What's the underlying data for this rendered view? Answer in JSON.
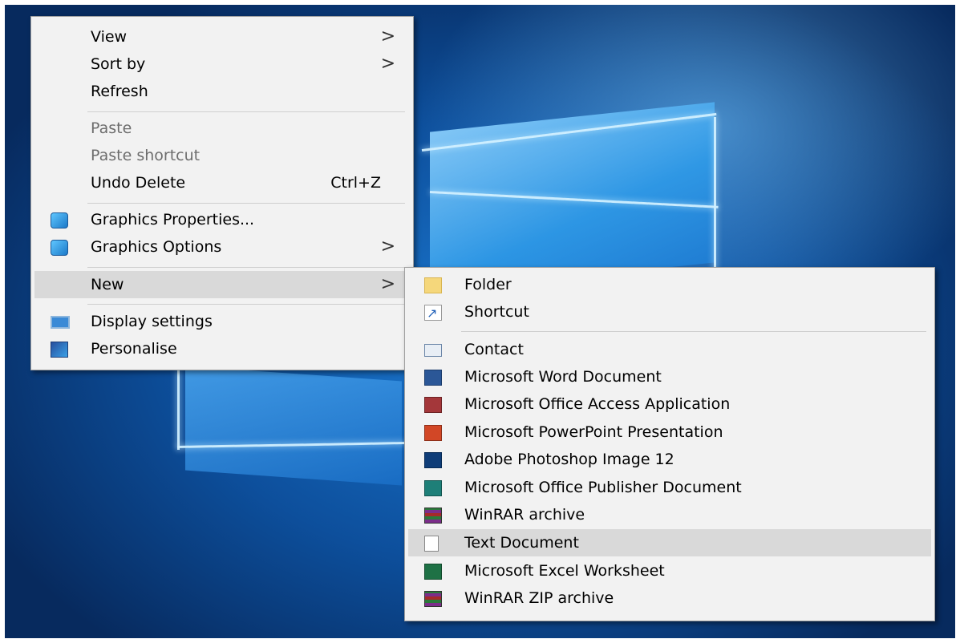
{
  "context_menu": {
    "view": "View",
    "sort_by": "Sort by",
    "refresh": "Refresh",
    "paste": "Paste",
    "paste_shortcut": "Paste shortcut",
    "undo_delete": "Undo Delete",
    "undo_shortcut": "Ctrl+Z",
    "graphics_properties": "Graphics Properties...",
    "graphics_options": "Graphics Options",
    "new": "New",
    "display_settings": "Display settings",
    "personalise": "Personalise",
    "submenu_arrow": ">"
  },
  "new_submenu": {
    "folder": "Folder",
    "shortcut": "Shortcut",
    "contact": "Contact",
    "word": "Microsoft Word Document",
    "access": "Microsoft Office Access Application",
    "powerpoint": "Microsoft PowerPoint Presentation",
    "photoshop": "Adobe Photoshop Image 12",
    "publisher": "Microsoft Office Publisher Document",
    "winrar": "WinRAR archive",
    "text": "Text Document",
    "excel": "Microsoft Excel Worksheet",
    "winrar_zip": "WinRAR ZIP archive"
  },
  "state": {
    "disabled_items": [
      "Paste",
      "Paste shortcut"
    ],
    "highlighted_items": [
      "New",
      "Text Document"
    ]
  },
  "icons": {
    "graphics_properties": "graphics-icon",
    "graphics_options": "graphics-icon",
    "display_settings": "display-icon",
    "personalise": "personalise-icon",
    "folder": "folder-icon",
    "shortcut": "shortcut-icon",
    "contact": "contact-icon",
    "word": "word-icon",
    "access": "access-icon",
    "powerpoint": "powerpoint-icon",
    "photoshop": "photoshop-icon",
    "publisher": "publisher-icon",
    "winrar": "winrar-icon",
    "text": "text-document-icon",
    "excel": "excel-icon",
    "winrar_zip": "winrar-zip-icon"
  },
  "colors": {
    "menu_background": "#f2f2f2",
    "highlight": "#d9d9d9",
    "disabled_text": "#6d6d6d",
    "desktop_blue": "#0d4f9c"
  }
}
